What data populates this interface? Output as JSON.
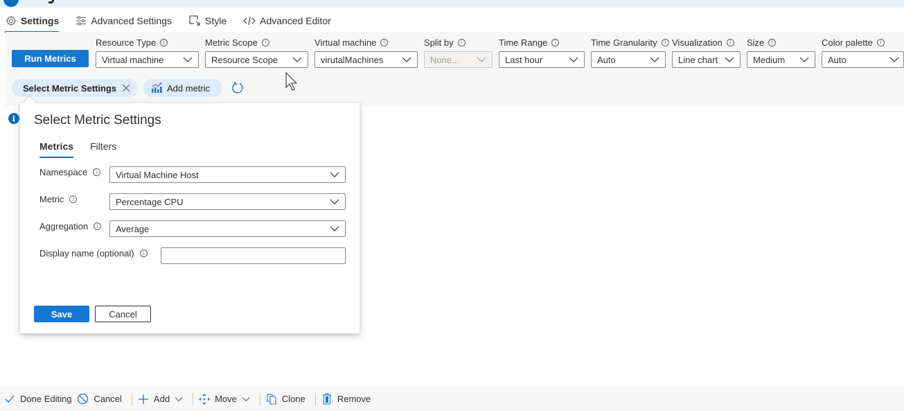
{
  "tabs": [
    {
      "label": "Settings",
      "icon": "gear-icon",
      "active": true
    },
    {
      "label": "Advanced Settings",
      "icon": "sliders-icon",
      "active": false
    },
    {
      "label": "Style",
      "icon": "style-icon",
      "active": false
    },
    {
      "label": "Advanced Editor",
      "icon": "code-icon",
      "active": false
    }
  ],
  "toolbar": {
    "run_label": "Run Metrics",
    "fields": [
      {
        "label": "Resource Type",
        "value": "Virtual machine"
      },
      {
        "label": "Metric Scope",
        "value": "Resource Scope"
      },
      {
        "label": "Virtual machine",
        "value": "virutalMachines"
      },
      {
        "label": "Split by",
        "value": "None...",
        "disabled": true
      },
      {
        "label": "Time Range",
        "value": "Last hour"
      },
      {
        "label": "Time Granularity",
        "value": "Auto"
      },
      {
        "label": "Visualization",
        "value": "Line chart"
      },
      {
        "label": "Size",
        "value": "Medium"
      },
      {
        "label": "Color palette",
        "value": "Auto"
      }
    ]
  },
  "pills": {
    "select_label": "Select Metric Settings",
    "add_label": "Add metric"
  },
  "callout": {
    "title": "Select Metric Settings",
    "tabs": [
      {
        "label": "Metrics",
        "active": true
      },
      {
        "label": "Filters",
        "active": false
      }
    ],
    "namespace": {
      "label": "Namespace",
      "value": "Virtual Machine Host"
    },
    "metric": {
      "label": "Metric",
      "value": "Percentage CPU"
    },
    "aggregation": {
      "label": "Aggregation",
      "value": "Average"
    },
    "display_name": {
      "label": "Display name (optional)",
      "value": "",
      "placeholder": ""
    },
    "save_label": "Save",
    "cancel_label": "Cancel"
  },
  "bottombar": {
    "done": "Done Editing",
    "cancel": "Cancel",
    "add": "Add",
    "move": "Move",
    "clone": "Clone",
    "remove": "Remove"
  },
  "colors": {
    "accent": "#1677d2",
    "pill_bg": "#deecf9",
    "panel_bg": "#f7f7f7"
  }
}
